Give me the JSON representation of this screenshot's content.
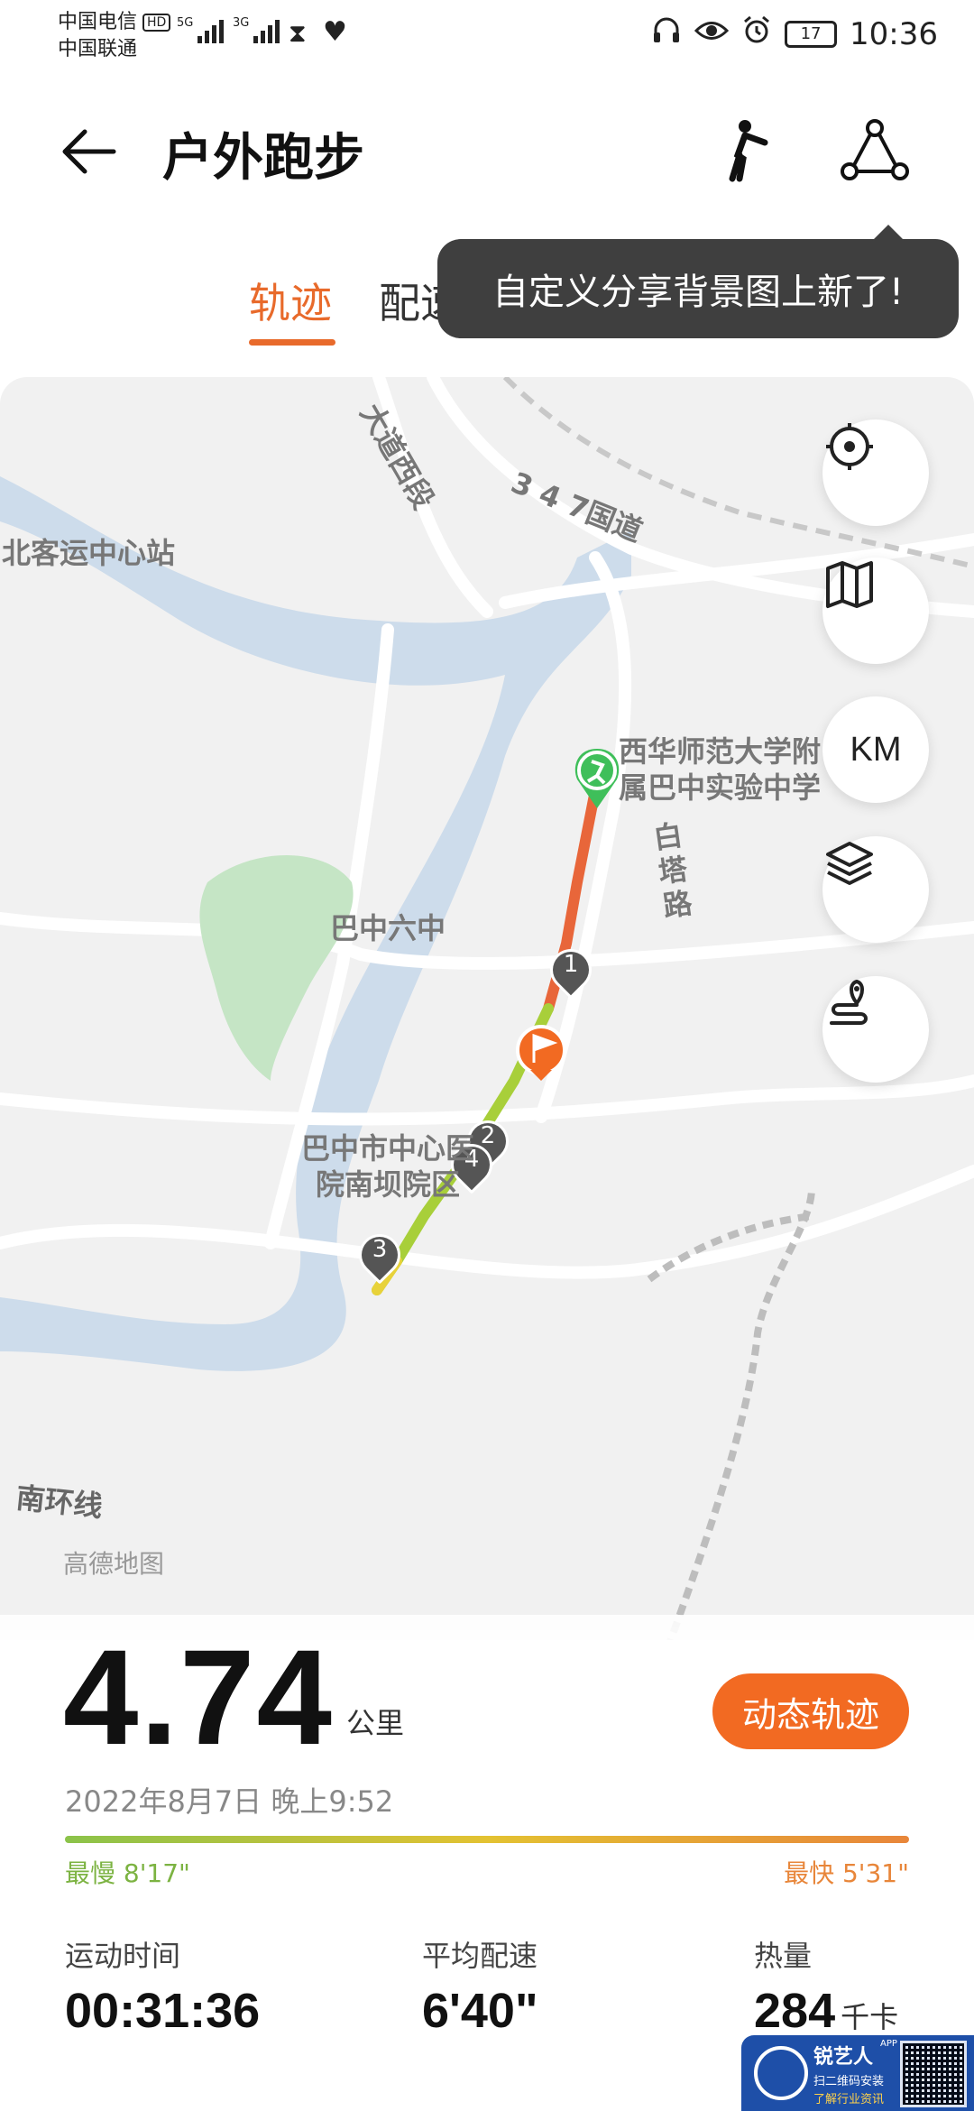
{
  "status_bar": {
    "carrier1": "中国电信",
    "hd": "HD",
    "carrier2": "中国联通",
    "net1": "5G",
    "net2": "3G",
    "battery": "17",
    "time": "10:36"
  },
  "header": {
    "title": "户外跑步",
    "back_icon": "arrow-left-icon",
    "pose_icon": "runner-pose-icon",
    "share_icon": "share-icon"
  },
  "tabs": [
    {
      "label": "轨迹",
      "active": true
    },
    {
      "label": "配速",
      "active": false
    }
  ],
  "tooltip": "自定义分享背景图上新了!",
  "map": {
    "labels": {
      "road1": "大道西段",
      "road2": "3 4 7国道",
      "station": "北客运中心站",
      "school": "西华师范大学附属巴中实验中学",
      "school_l1": "西华师范大学附",
      "school_l2": "属巴中实验中学",
      "baita": "白塔路",
      "bazhong6": "巴中六中",
      "hospital_l1": "巴中市中心医",
      "hospital_l2": "院南坝院区",
      "nanhuan": "南环线",
      "provider": "高德地图"
    },
    "markers": [
      "1",
      "2",
      "4",
      "3"
    ],
    "buttons": [
      {
        "name": "locate-button",
        "icon": "locate-icon"
      },
      {
        "name": "map-type-button",
        "icon": "map-icon"
      },
      {
        "name": "km-button",
        "label": "KM"
      },
      {
        "name": "layers-button",
        "icon": "layers-icon"
      },
      {
        "name": "route-button",
        "icon": "route-pin-icon"
      }
    ]
  },
  "summary": {
    "distance": "4.74",
    "distance_unit": "公里",
    "dynamic_button": "动态轨迹",
    "datetime": "2022年8月7日 晚上9:52",
    "slowest": "最慢 8'17\"",
    "fastest": "最快 5'31\"",
    "stats": [
      {
        "label": "运动时间",
        "value": "00:31:36",
        "unit": ""
      },
      {
        "label": "平均配速",
        "value": "6'40\"",
        "unit": ""
      },
      {
        "label": "热量",
        "value": "284",
        "unit": "千卡"
      }
    ]
  },
  "watermark": {
    "name": "锐艺人",
    "app": "APP",
    "line1": "扫二维码安装",
    "line2": "了解行业资讯"
  },
  "colors": {
    "accent": "#e86a2b",
    "button": "#f26a22",
    "route_fast": "#e8663a",
    "route_slow": "#a8cf3a",
    "water": "#cddceb"
  }
}
